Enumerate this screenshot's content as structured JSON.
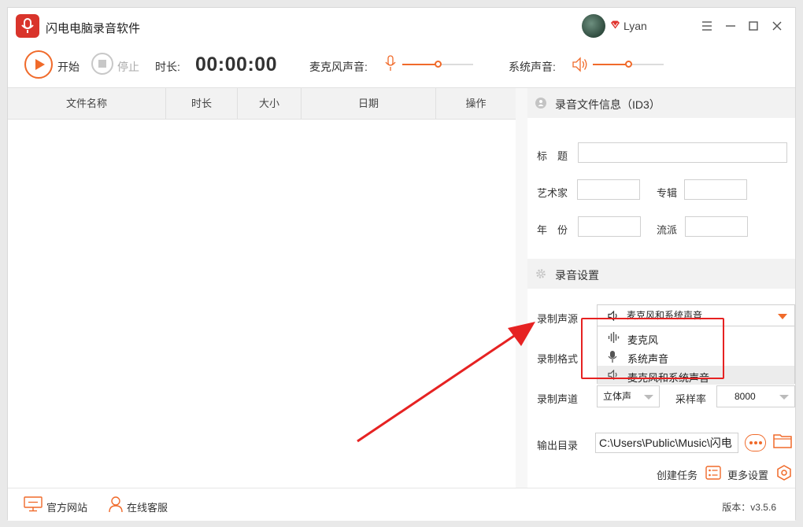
{
  "app": {
    "title": "闪电电脑录音软件",
    "username": "Lyan"
  },
  "toolbar": {
    "start_label": "开始",
    "stop_label": "停止",
    "duration_label": "时长:",
    "timer": "00:00:00",
    "mic_label": "麦克风声音:",
    "mic_volume_fraction": 0.5,
    "system_label": "系统声音:",
    "system_volume_fraction": 0.5
  },
  "table": {
    "columns": [
      "文件名称",
      "时长",
      "大小",
      "日期",
      "操作"
    ],
    "rows": []
  },
  "id3": {
    "section_title": "录音文件信息（ID3）",
    "title_label": "标　题",
    "title_value": "",
    "artist_label": "艺术家",
    "artist_value": "",
    "album_label": "专辑",
    "album_value": "",
    "year_label": "年　份",
    "year_value": "",
    "genre_label": "流派",
    "genre_value": ""
  },
  "settings": {
    "section_title": "录音设置",
    "source_label": "录制声源",
    "source_value": "麦克风和系统声音",
    "source_options": [
      "麦克风",
      "系统声音",
      "麦克风和系统声音"
    ],
    "format_label": "录制格式",
    "channel_label": "录制声道",
    "channel_value": "立体声",
    "samplerate_label": "采样率",
    "samplerate_value": "8000",
    "output_label": "输出目录",
    "output_value": "C:\\Users\\Public\\Music\\闪电",
    "create_task_label": "创建任务",
    "more_settings_label": "更多设置"
  },
  "footer": {
    "website_label": "官方网站",
    "support_label": "在线客服",
    "version": "版本：v3.5.6"
  },
  "colors": {
    "accent": "#f06a2a",
    "brand": "#d9342b",
    "annotation": "#e62222"
  }
}
